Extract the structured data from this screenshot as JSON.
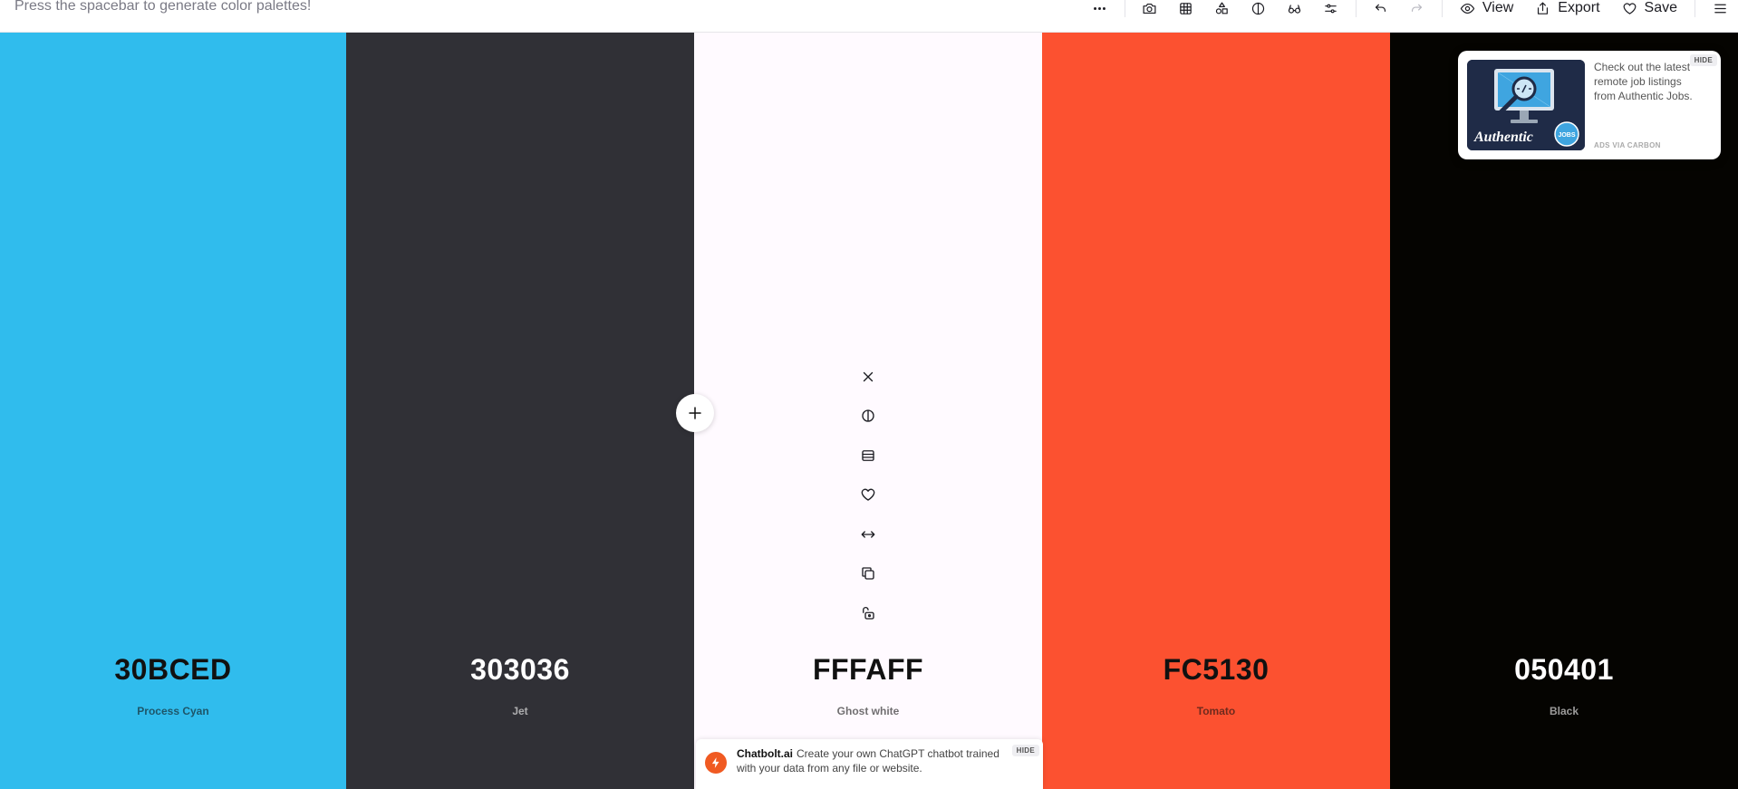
{
  "header": {
    "hint": "Press the spacebar to generate color palettes!",
    "view_label": "View",
    "export_label": "Export",
    "save_label": "Save"
  },
  "palette": [
    {
      "hex": "30BCED",
      "name": "Process Cyan",
      "color": "#30BCED",
      "text_color": "#111111"
    },
    {
      "hex": "303036",
      "name": "Jet",
      "color": "#303036",
      "text_color": "#FFFFFF"
    },
    {
      "hex": "FFFAFF",
      "name": "Ghost white",
      "color": "#FFFAFF",
      "text_color": "#111111"
    },
    {
      "hex": "FC5130",
      "name": "Tomato",
      "color": "#FC5130",
      "text_color": "#111111"
    },
    {
      "hex": "050401",
      "name": "Black",
      "color": "#050401",
      "text_color": "#FFFFFF"
    }
  ],
  "ad": {
    "text": "Check out the latest remote job listings from Authentic Jobs.",
    "via": "ADS VIA CARBON",
    "hide": "HIDE",
    "image_brand": "Authentic",
    "image_badge": "JOBS"
  },
  "banner": {
    "brand": "Chatbolt.ai",
    "text": "Create your own ChatGPT chatbot trained with your data from any file or website.",
    "hide": "HIDE"
  }
}
